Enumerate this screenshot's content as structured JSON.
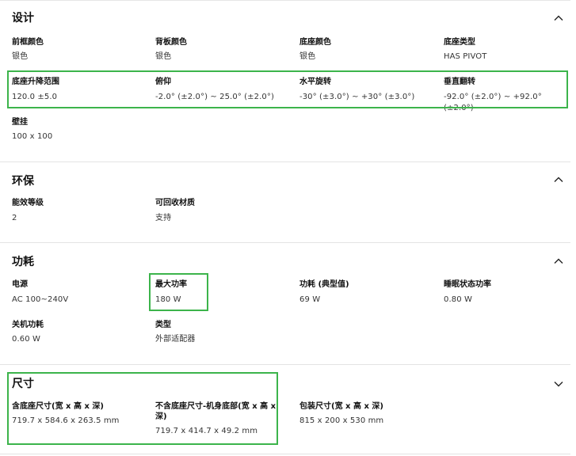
{
  "sections": {
    "design": {
      "title": "设计",
      "specs": [
        {
          "label": "前框颜色",
          "value": "银色"
        },
        {
          "label": "背板颜色",
          "value": "银色"
        },
        {
          "label": "底座颜色",
          "value": "银色"
        },
        {
          "label": "底座类型",
          "value": "HAS PIVOT"
        },
        {
          "label": "底座升降范围",
          "value": "120.0 ±5.0"
        },
        {
          "label": "俯仰",
          "value": "-2.0° (±2.0°) ~ 25.0° (±2.0°)"
        },
        {
          "label": "水平旋转",
          "value": "-30° (±3.0°) ~ +30° (±3.0°)"
        },
        {
          "label": "垂直翻转",
          "value": "-92.0° (±2.0°) ~ +92.0° (±2.0°)"
        },
        {
          "label": "壁挂",
          "value": "100 x 100"
        }
      ]
    },
    "environment": {
      "title": "环保",
      "specs": [
        {
          "label": "能效等级",
          "value": "2"
        },
        {
          "label": "可回收材质",
          "value": "支持"
        }
      ]
    },
    "power": {
      "title": "功耗",
      "specs": [
        {
          "label": "电源",
          "value": "AC 100~240V"
        },
        {
          "label": "最大功率",
          "value": "180 W"
        },
        {
          "label": "功耗 (典型值)",
          "value": "69 W"
        },
        {
          "label": "睡眠状态功率",
          "value": "0.80 W"
        },
        {
          "label": "关机功耗",
          "value": "0.60 W"
        },
        {
          "label": "类型",
          "value": "外部适配器"
        }
      ]
    },
    "dimensions": {
      "title": "尺寸",
      "specs": [
        {
          "label": "含底座尺寸(宽 x 高 x 深)",
          "value": "719.7 x 584.6 x 263.5 mm"
        },
        {
          "label_line1": "不含底座尺寸-机身底部(宽 x 高 x",
          "label_line2": "深)",
          "value": "719.7 x 414.7 x 49.2 mm"
        },
        {
          "label": "包装尺寸(宽 x 高 x 深)",
          "value": "815 x 200 x 530 mm"
        }
      ]
    }
  },
  "icons": {
    "collapse": "chevron-up-icon"
  },
  "colors": {
    "highlight": "#3cb44b",
    "divider": "#e3e3e3",
    "text_primary": "#111111",
    "text_secondary": "#333333"
  }
}
